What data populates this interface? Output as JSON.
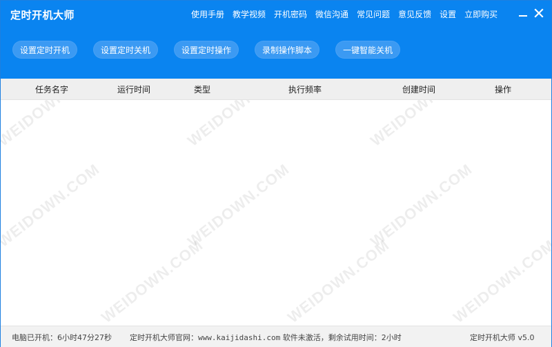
{
  "app": {
    "title": "定时开机大师",
    "accent_color": "#0a84f0",
    "button_color": "#3b9af3"
  },
  "menu": {
    "items": [
      "使用手册",
      "教学视频",
      "开机密码",
      "微信沟通",
      "常见问题",
      "意见反馈",
      "设置",
      "立即购买"
    ]
  },
  "window_controls": {
    "minimize_icon": "minimize-icon",
    "close_icon": "close-icon"
  },
  "toolbar": {
    "buttons": [
      "设置定时开机",
      "设置定时关机",
      "设置定时操作",
      "录制操作脚本",
      "一键智能关机"
    ]
  },
  "table": {
    "columns": [
      "任务名字",
      "运行时间",
      "类型",
      "执行频率",
      "创建时间",
      "操作"
    ],
    "rows": []
  },
  "watermark": {
    "text": "WEIDOWN.COM"
  },
  "status": {
    "uptime": "电脑已开机：6小时47分27秒",
    "site_prefix": "定时开机大师官网：",
    "site_url": "www.kaijidashi.com",
    "trial": " 软件未激活，剩余试用时间：2小时",
    "version": "定时开机大师 v5.0"
  }
}
